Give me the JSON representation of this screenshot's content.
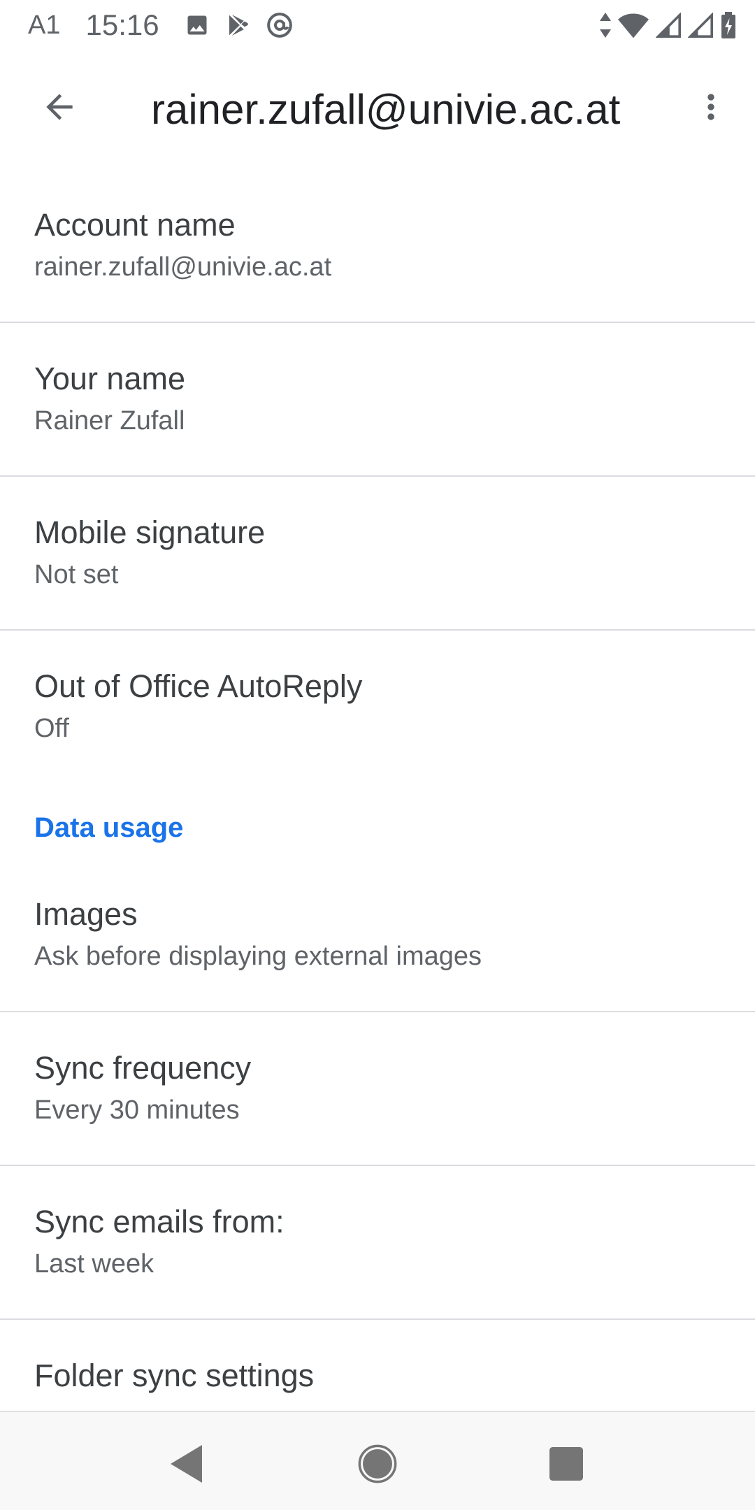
{
  "status_bar": {
    "carrier": "A1",
    "time": "15:16",
    "icons_left": [
      "image-icon",
      "play-store-icon",
      "at-sign-icon"
    ],
    "icons_right": [
      "data-arrows-icon",
      "wifi-icon",
      "signal-icon",
      "signal-icon",
      "battery-charging-icon"
    ]
  },
  "app_bar": {
    "title": "rainer.zufall@univie.ac.at",
    "back_icon": "arrow-back-icon",
    "overflow_icon": "more-vert-icon"
  },
  "settings": {
    "account_name": {
      "title": "Account name",
      "summary": "rainer.zufall@univie.ac.at"
    },
    "your_name": {
      "title": "Your name",
      "summary": "Rainer Zufall"
    },
    "mobile_signature": {
      "title": "Mobile signature",
      "summary": "Not set"
    },
    "out_of_office": {
      "title": "Out of Office AutoReply",
      "summary": "Off"
    },
    "data_usage_header": "Data usage",
    "images": {
      "title": "Images",
      "summary": "Ask before displaying external images"
    },
    "sync_frequency": {
      "title": "Sync frequency",
      "summary": "Every 30 minutes"
    },
    "sync_emails_from": {
      "title": "Sync emails from:",
      "summary": "Last week"
    },
    "folder_sync": {
      "title": "Folder sync settings"
    }
  },
  "nav_bar": {
    "icons": [
      "nav-back-icon",
      "nav-home-icon",
      "nav-recents-icon"
    ]
  },
  "colors": {
    "accent": "#1a73e8",
    "title_text": "#3c4043",
    "summary_text": "#5f6368",
    "divider": "#dadce0",
    "nav_bg": "#f8f8f8"
  }
}
